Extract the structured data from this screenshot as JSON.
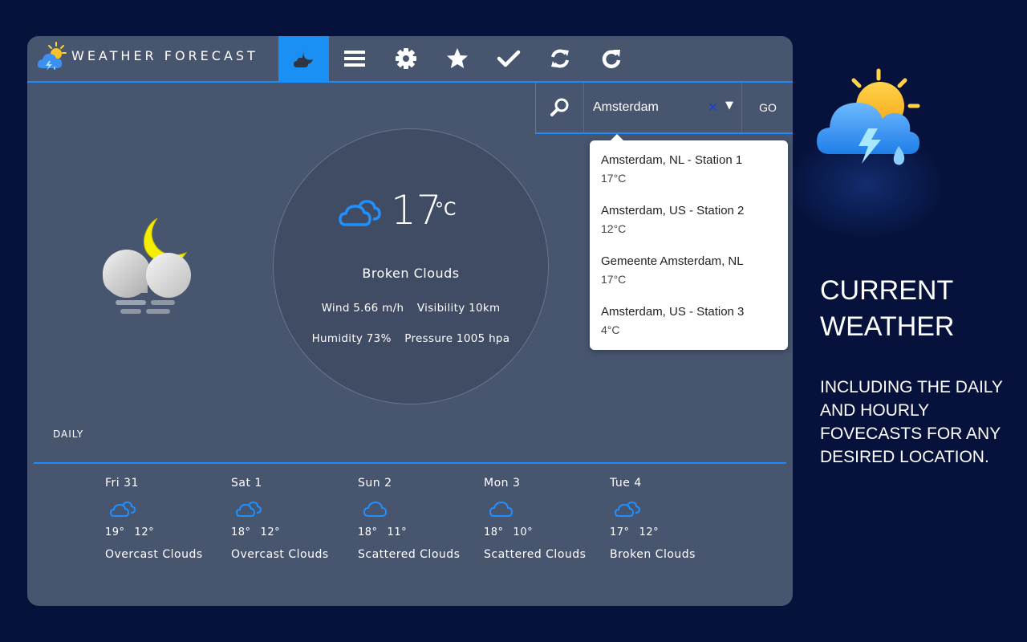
{
  "app": {
    "title": "WEATHER FORECAST",
    "accent_color": "#1a90f5",
    "nav": [
      {
        "name": "night-mode",
        "icon": "moon-cloud-icon",
        "active": true
      },
      {
        "name": "menu",
        "icon": "hamburger-icon",
        "active": false
      },
      {
        "name": "settings",
        "icon": "gear-icon",
        "active": false
      },
      {
        "name": "favorites",
        "icon": "star-icon",
        "active": false
      },
      {
        "name": "confirm",
        "icon": "check-icon",
        "active": false
      },
      {
        "name": "sync",
        "icon": "sync-icon",
        "active": false
      },
      {
        "name": "refresh",
        "icon": "refresh-icon",
        "active": false
      }
    ]
  },
  "search": {
    "value": "Amsterdam",
    "clear_label": "✕",
    "dropdown_arrow": "▼",
    "go_label": "GO",
    "suggestions": [
      {
        "name": "Amsterdam, NL - Station 1",
        "temp": "17°C"
      },
      {
        "name": "Amsterdam, US - Station 2",
        "temp": "12°C"
      },
      {
        "name": "Gemeente Amsterdam, NL",
        "temp": "17°C"
      },
      {
        "name": "Amsterdam, US - Station 3",
        "temp": "4°C"
      }
    ]
  },
  "current": {
    "temp": "17",
    "unit": "°C",
    "description": "Broken Clouds",
    "wind": "Wind 5.66 m/h",
    "visibility": "Visibility 10km",
    "humidity": "Humidity 73%",
    "pressure": "Pressure 1005 hpa"
  },
  "daily": {
    "label": "DAILY",
    "days": [
      {
        "day": "Fri 31",
        "high": "19°",
        "low": "12°",
        "desc": "Overcast Clouds",
        "icon": "double-cloud-icon"
      },
      {
        "day": "Sat 1",
        "high": "18°",
        "low": "12°",
        "desc": "Overcast Clouds",
        "icon": "double-cloud-icon"
      },
      {
        "day": "Sun 2",
        "high": "18°",
        "low": "11°",
        "desc": "Scattered Clouds",
        "icon": "cloud-icon"
      },
      {
        "day": "Mon 3",
        "high": "18°",
        "low": "10°",
        "desc": "Scattered Clouds",
        "icon": "cloud-icon"
      },
      {
        "day": "Tue 4",
        "high": "17°",
        "low": "12°",
        "desc": "Broken Clouds",
        "icon": "double-cloud-icon"
      }
    ]
  },
  "promo": {
    "title_line1": "CURRENT",
    "title_line2": "WEATHER",
    "sub_line1": "INCLUDING THE DAILY",
    "sub_line2": "AND HOURLY",
    "sub_line3": "FOVECASTS FOR ANY",
    "sub_line4": "DESIRED LOCATION."
  }
}
